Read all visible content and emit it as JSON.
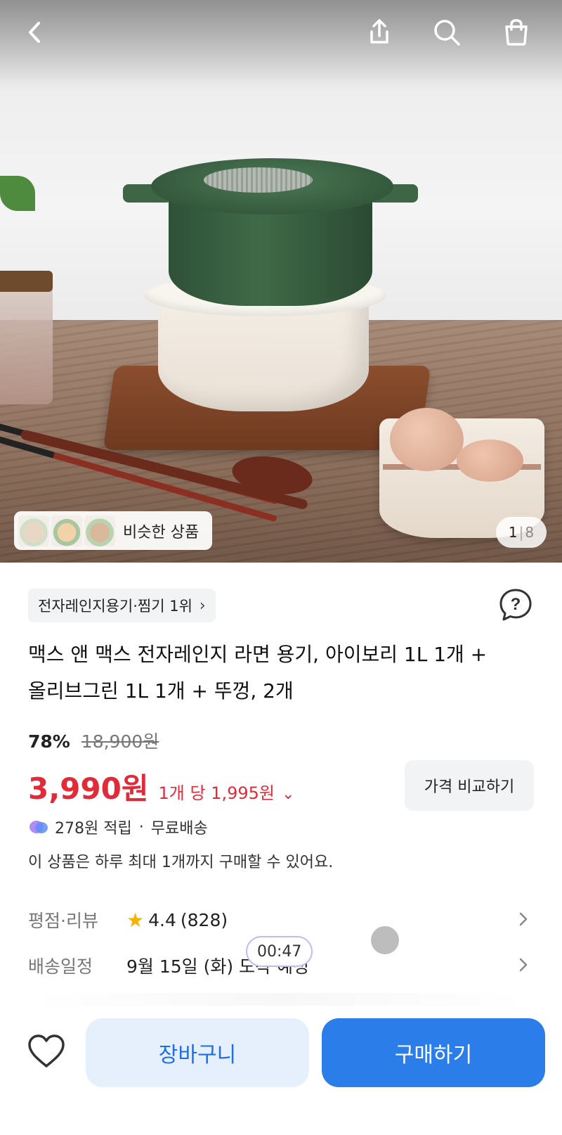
{
  "gallery": {
    "similar_label": "비슷한 상품",
    "page_current": "1",
    "page_total": "8"
  },
  "product": {
    "rank_badge": "전자레인지용기·찜기 1위",
    "title_line1": "맥스 앤 맥스 전자레인지 라면 용기, 아이보리 1L 1개 +",
    "title_line2": "올리브그린 1L 1개 + 뚜껑, 2개",
    "discount_percent": "78%",
    "original_price": "18,900원",
    "price": "3,990원",
    "unit_price": "1개 당 1,995원",
    "compare_label": "가격 비교하기",
    "points": "278원 적립",
    "shipping": "무료배송",
    "purchase_limit": "이 상품은 하루 최대 1개까지 구매할 수 있어요."
  },
  "rating_row": {
    "label": "평점·리뷰",
    "rating": "4.4",
    "count": "(828)"
  },
  "delivery_row": {
    "label": "배송일정",
    "value": "9월 15일 (화) 도착 예정"
  },
  "overlay": {
    "timer": "00:47"
  },
  "actions": {
    "cart_label": "장바구니",
    "buy_label": "구매하기"
  },
  "colors": {
    "accent_blue": "#2b7de9",
    "price_red": "#e22b39",
    "star": "#f5b301"
  }
}
